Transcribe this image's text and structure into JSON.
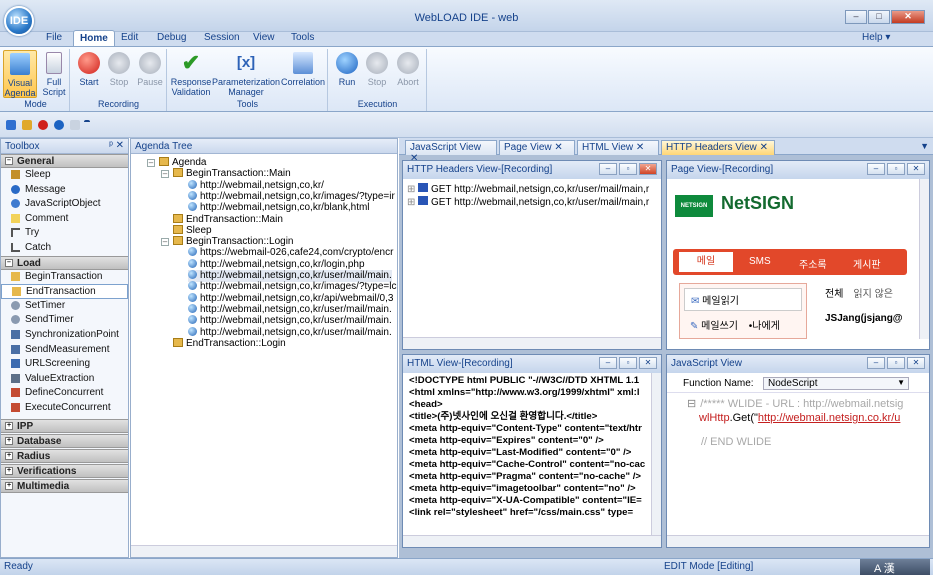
{
  "app": {
    "logo_text": "IDE",
    "title": "WebLOAD IDE - web",
    "help": "Help ▾"
  },
  "window_buttons": {
    "minimize": "–",
    "maximize": "□",
    "close": "✕"
  },
  "menu": {
    "tabs": [
      "File",
      "Home",
      "Edit",
      "Debug",
      "Session",
      "View",
      "Tools"
    ],
    "active": "Home"
  },
  "ribbon": {
    "mode": {
      "label": "Mode",
      "visual": "Visual\nAgenda",
      "full": "Full\nScript"
    },
    "recording": {
      "label": "Recording",
      "start": "Start",
      "stop": "Stop",
      "pause": "Pause"
    },
    "tools": {
      "label": "Tools",
      "response": "Response\nValidation",
      "param": "Parameterization\nManager",
      "correlation": "Correlation"
    },
    "execution": {
      "label": "Execution",
      "run": "Run",
      "stop": "Stop",
      "abort": "Abort"
    }
  },
  "toolbox": {
    "title": "Toolbox",
    "pin": "ᵖ ✕",
    "general_label": "General",
    "general_items": [
      "Sleep",
      "Message",
      "JavaScriptObject",
      "Comment",
      "Try",
      "Catch"
    ],
    "load_label": "Load",
    "load_items": [
      "BeginTransaction",
      "EndTransaction",
      "SetTimer",
      "SendTimer",
      "SynchronizationPoint",
      "SendMeasurement",
      "URLScreening",
      "ValueExtraction",
      "DefineConcurrent",
      "ExecuteConcurrent"
    ],
    "collapsed": [
      "IPP",
      "Database",
      "Radius",
      "Verifications",
      "Multimedia"
    ]
  },
  "agenda": {
    "title": "Agenda Tree",
    "nodes": [
      {
        "text": "Agenda",
        "indent": 0,
        "kind": "t"
      },
      {
        "text": "BeginTransaction::Main",
        "indent": 1,
        "kind": "t"
      },
      {
        "text": "http://webmail,netsign,co,kr/",
        "indent": 2,
        "kind": "g"
      },
      {
        "text": "http://webmail,netsign,co,kr/images/?type=ir",
        "indent": 2,
        "kind": "g"
      },
      {
        "text": "http://webmail,netsign,co,kr/blank,html",
        "indent": 2,
        "kind": "g"
      },
      {
        "text": "EndTransaction::Main",
        "indent": 1,
        "kind": "t"
      },
      {
        "text": "Sleep",
        "indent": 1,
        "kind": "t"
      },
      {
        "text": "BeginTransaction::Login",
        "indent": 1,
        "kind": "t"
      },
      {
        "text": "https://webmail-026,cafe24,com/crypto/encr",
        "indent": 2,
        "kind": "g"
      },
      {
        "text": "http://webmail,netsign,co,kr/login,php",
        "indent": 2,
        "kind": "g"
      },
      {
        "text": "http://webmail,netsign,co,kr/user/mail/main.",
        "indent": 2,
        "kind": "g"
      },
      {
        "text": "http://webmail,netsign,co,kr/images/?type=lc",
        "indent": 2,
        "kind": "g"
      },
      {
        "text": "http://webmail,netsign,co,kr/api/webmail/0,3",
        "indent": 2,
        "kind": "g"
      },
      {
        "text": "http://webmail,netsign,co,kr/user/mail/main.",
        "indent": 2,
        "kind": "g"
      },
      {
        "text": "http://webmail,netsign,co,kr/user/mail/main.",
        "indent": 2,
        "kind": "g"
      },
      {
        "text": "http://webmail,netsign,co,kr/user/mail/main.",
        "indent": 2,
        "kind": "g"
      },
      {
        "text": "EndTransaction::Login",
        "indent": 1,
        "kind": "t"
      }
    ]
  },
  "doc_tabs": [
    "JavaScript View",
    "Page View",
    "HTML View",
    "HTTP Headers View"
  ],
  "http": {
    "title": "HTTP Headers View-[Recording]",
    "rows": [
      "GET http://webmail,netsign,co,kr/user/mail/main,r",
      "GET http://webmail,netsign,co,kr/user/mail/main,r"
    ]
  },
  "page": {
    "title": "Page View-[Recording]",
    "brand": "NetSIGN",
    "brand_small": "NETSIGN",
    "tabs": [
      "메일",
      "SMS",
      "주소록",
      "게시판"
    ],
    "side": [
      "메일읽기",
      "메일쓰기"
    ],
    "side_extra": "•나에게",
    "right_top": [
      "전체",
      "읽지 않은"
    ],
    "user": "JSJang(jsjang@"
  },
  "html": {
    "title": "HTML View-[Recording]",
    "lines": [
      "<!DOCTYPE html PUBLIC \"-//W3C//DTD XHTML 1.1",
      "<html xmlns=\"http://www.w3.org/1999/xhtml\" xml:l",
      "<head>",
      "<title>(주)넷사인에 오신걸 환영합니다.</title>",
      "<meta http-equiv=\"Content-Type\" content=\"text/htr",
      "<meta http-equiv=\"Expires\" content=\"0\" />",
      "<meta http-equiv=\"Last-Modified\" content=\"0\" />",
      "<meta http-equiv=\"Cache-Control\" content=\"no-cac",
      "<meta http-equiv=\"Pragma\" content=\"no-cache\" />",
      "<meta http-equiv=\"imagetoolbar\" content=\"no\" />",
      "<meta http-equiv=\"X-UA-Compatible\" content=\"IE=",
      "<link rel=\"stylesheet\" href=\"/css/main.css\" type="
    ]
  },
  "js": {
    "title": "JavaScript View",
    "fn_label": "Function Name:",
    "fn_value": "NodeScript",
    "comment1": "/***** WLIDE - URL : http://webmail.netsig",
    "code_obj": "wlHttp",
    "code_call": ".Get(\"",
    "code_url": "http://webmail.netsign.co.kr/u",
    "comment2": "// END WLIDE"
  },
  "status": {
    "left": "Ready",
    "mode": "EDIT Mode [Editing]",
    "right": "A 漢"
  }
}
